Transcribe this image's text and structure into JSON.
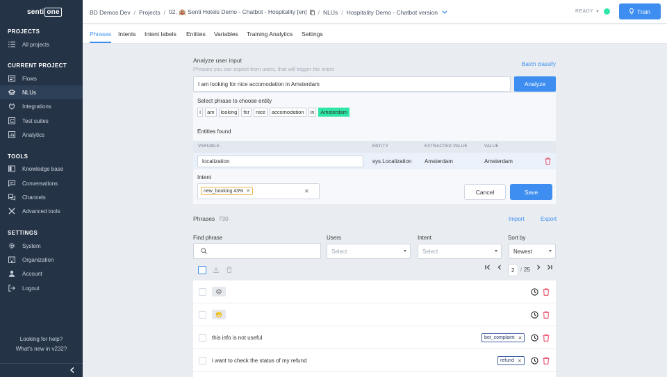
{
  "logo": {
    "prefix": "senti",
    "boxed": "one"
  },
  "sidebar": {
    "sections": {
      "projects": "PROJECTS",
      "current": "CURRENT PROJECT",
      "tools": "TOOLS",
      "settings": "SETTINGS"
    },
    "items": {
      "all_projects": "All projects",
      "flows": "Flows",
      "nlus": "NLUs",
      "integrations": "Integrations",
      "test_suites": "Test suites",
      "analytics": "Analytics",
      "knowledge_base": "Knowledge base",
      "conversations": "Conversations",
      "channels": "Channels",
      "advanced_tools": "Advanced tools",
      "system": "System",
      "organization": "Organization",
      "account": "Account",
      "logout": "Logout"
    },
    "help": "Looking for help?",
    "whats_new": "What's new in v232?"
  },
  "breadcrumb": {
    "org": "BD Demos Dev",
    "projects": "Projects",
    "project": "02. 🏨 Senti Hotels Demo - Chatbot - Hospitality [en]",
    "nlus": "NLUs",
    "version": "Hospitality Demo - Chatbot version"
  },
  "status": {
    "label": "READY",
    "color": "#2ee6a6"
  },
  "train_button": "Train",
  "tabs": [
    "Phrases",
    "Intents",
    "Intent labels",
    "Entities",
    "Variables",
    "Training Analytics",
    "Settings"
  ],
  "analyze": {
    "title": "Analyze user input",
    "subtitle": "Phrases you can expect from users, that will trigger the intent",
    "batch_classify": "Batch classify",
    "input_value": "I am looking for nice accomodation in Amsterdam",
    "button": "Analyze",
    "select_phrase_label": "Select phrase to choose entity",
    "tokens": [
      "I",
      "am",
      "looking",
      "for",
      "nice",
      "accomodation",
      "in",
      "Amsterdam"
    ],
    "highlighted_token": "Amsterdam",
    "entities_found": "Entities found",
    "columns": {
      "variable": "VARIABLE",
      "entity": "ENTITY",
      "extracted": "EXTRACTED VALUE",
      "value": "VALUE"
    },
    "row": {
      "variable": "localization",
      "entity": "sys.Localization",
      "extracted": "Amsterdam",
      "value": "Amsterdam"
    },
    "intent_label": "Intent",
    "intent_chip": "new_booking 43%",
    "cancel": "Cancel",
    "save": "Save"
  },
  "phrases": {
    "title": "Phrases",
    "count": "730",
    "import": "Import",
    "export": "Export",
    "filters": {
      "find_label": "Find phrase",
      "users_label": "Users",
      "users_placeholder": "Select",
      "intent_label": "Intent",
      "intent_placeholder": "Select",
      "sort_label": "Sort by",
      "sort_value": "Newest"
    },
    "pager": {
      "current": "2",
      "sep": "/",
      "total": "25"
    },
    "rows": [
      {
        "emoji": "😐",
        "text": "",
        "chip": ""
      },
      {
        "emoji": "😬",
        "text": "",
        "chip": ""
      },
      {
        "emoji": "",
        "text": "this info is not useful",
        "chip": "bot_complaint"
      },
      {
        "emoji": "",
        "text": "i want to check the status of my refund",
        "chip": "refund"
      }
    ]
  }
}
